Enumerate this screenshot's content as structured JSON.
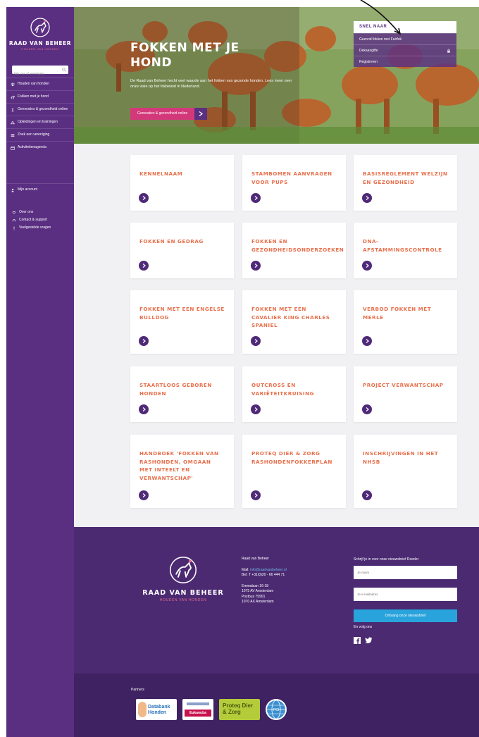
{
  "brand": {
    "name": "RAAD VAN BEHEER",
    "tagline": "HOUDEN VAN HONDEN"
  },
  "search": {
    "placeholder": "Bijv. ras of vereniging"
  },
  "sidebar": {
    "items": [
      {
        "label": "Houden van honden",
        "icon": "paw-icon"
      },
      {
        "label": "Fokken met je hond",
        "icon": "dog-icon"
      },
      {
        "label": "Generaties & gezondheid online",
        "icon": "dna-icon"
      },
      {
        "label": "Opleidingen en trainingen",
        "icon": "training-icon"
      },
      {
        "label": "Zoek een vereniging",
        "icon": "list-icon"
      },
      {
        "label": "Activiteitenagenda",
        "icon": "calendar-icon"
      }
    ],
    "account": {
      "label": "Mijn account",
      "icon": "user-icon"
    },
    "links": [
      {
        "label": "Over ons",
        "icon": "info-icon"
      },
      {
        "label": "Contact & support",
        "icon": "headset-icon"
      },
      {
        "label": "Veelgestelde vragen",
        "icon": "question-icon"
      }
    ]
  },
  "hero": {
    "title": "FOKKEN MET JE HOND",
    "text": "De Raad van Beheer hecht veel waarde aan het fokken van gezonde honden. Lees meer over onze visie op het fokbeleid in Nederland.",
    "button_label": "Generaties & gezondheid online"
  },
  "quick_links": {
    "title": "SNEL NAAR",
    "items": [
      "Gezond fokken met Fairfok",
      "Dekaangifte",
      "Registreren"
    ]
  },
  "cards": [
    {
      "title": "KENNELNAAM"
    },
    {
      "title": "STAMBOMEN AANVRAGEN VOOR PUPS"
    },
    {
      "title": "BASISREGLEMENT WELZIJN EN GEZONDHEID"
    },
    {
      "title": "FOKKEN EN GEDRAG"
    },
    {
      "title": "FOKKEN EN GEZONDHEIDSONDERZOEKEN"
    },
    {
      "title": "DNA-AFSTAMMINGSCONTROLE"
    },
    {
      "title": "FOKKEN MET EEN ENGELSE BULLDOG"
    },
    {
      "title": "FOKKEN MET EEN CAVALIER KING CHARLES SPANIEL"
    },
    {
      "title": "VERBOD FOKKEN MET MERLE"
    },
    {
      "title": "STAARTLOOS GEBOREN HONDEN"
    },
    {
      "title": "OUTCROSS EN VARIËTEITKRUISING"
    },
    {
      "title": "PROJECT VERWANTSCHAP"
    },
    {
      "title": "HANDBOEK 'FOKKEN VAN RASHONDEN, OMGAAN MET INTEELT EN VERWANTSCHAP'"
    },
    {
      "title": "PROTEQ DIER & ZORG RASHONDENFOKKERPLAN"
    },
    {
      "title": "INSCHRIJVINGEN IN HET NHSB"
    }
  ],
  "footer": {
    "org": "Raad van Beheer",
    "mail_label": "Mail:",
    "mail": "info@raadvanbeheer.nl",
    "phone_label": "Bel:",
    "phone": "T +31(0)20 - 66 444 71",
    "address": [
      "Emmalaan 16-18",
      "1075 AV Amsterdam",
      "Postbus 75901",
      "1070 AX Amsterdam"
    ],
    "newsletter_label": "Schrijf je in voor onze nieuwsbrief Roeder",
    "name_placeholder": "Je naam",
    "email_placeholder": "Je e-mailadres",
    "subscribe_label": "Ontvang onze nieuwsbrief",
    "follow_label": "En volg ons",
    "partners_label": "Partners",
    "partners": [
      "Databank Honden",
      "Eukanuba",
      "Proteq Dier & Zorg",
      "FCI"
    ]
  },
  "colors": {
    "sidebar": "#5a2f82",
    "accent": "#e8704c",
    "pink": "#d3397a",
    "footer": "#4b2a72",
    "button_blue": "#29a3dc"
  }
}
